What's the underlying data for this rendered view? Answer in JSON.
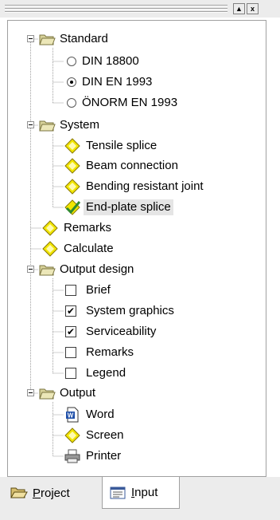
{
  "window": {
    "up_button": "▲",
    "close_button": "x"
  },
  "tree": {
    "standard": {
      "label": "Standard",
      "options": [
        {
          "label": "DIN 18800",
          "selected": false
        },
        {
          "label": "DIN EN 1993",
          "selected": true
        },
        {
          "label": "ÖNORM EN 1993",
          "selected": false
        }
      ]
    },
    "system": {
      "label": "System",
      "items": [
        {
          "label": "Tensile splice",
          "icon": "diamond-icon"
        },
        {
          "label": "Beam connection",
          "icon": "diamond-icon"
        },
        {
          "label": "Bending resistant joint",
          "icon": "diamond-icon"
        },
        {
          "label": "End-plate splice",
          "icon": "diamond-checked-icon",
          "selected": true
        }
      ]
    },
    "remarks": {
      "label": "Remarks",
      "icon": "diamond-icon"
    },
    "calculate": {
      "label": "Calculate",
      "icon": "diamond-icon"
    },
    "output_design": {
      "label": "Output design",
      "items": [
        {
          "label": "Brief",
          "checked": false
        },
        {
          "label": "System graphics",
          "checked": true
        },
        {
          "label": "Serviceability",
          "checked": true
        },
        {
          "label": "Remarks",
          "checked": false
        },
        {
          "label": "Legend",
          "checked": false
        }
      ]
    },
    "output": {
      "label": "Output",
      "items": [
        {
          "label": "Word",
          "icon": "word-document-icon"
        },
        {
          "label": "Screen",
          "icon": "diamond-icon"
        },
        {
          "label": "Printer",
          "icon": "printer-icon"
        }
      ]
    }
  },
  "tabs": [
    {
      "label_first": "P",
      "label_rest": "roject",
      "icon": "open-folder-icon",
      "active": false
    },
    {
      "label_first": "I",
      "label_rest": "nput",
      "icon": "form-icon",
      "active": true
    }
  ],
  "colors": {
    "folder": "#d8d29a",
    "diamond": "#f2e600",
    "tab_bg": "#ececec",
    "selected_bg": "#e5e5e5"
  }
}
